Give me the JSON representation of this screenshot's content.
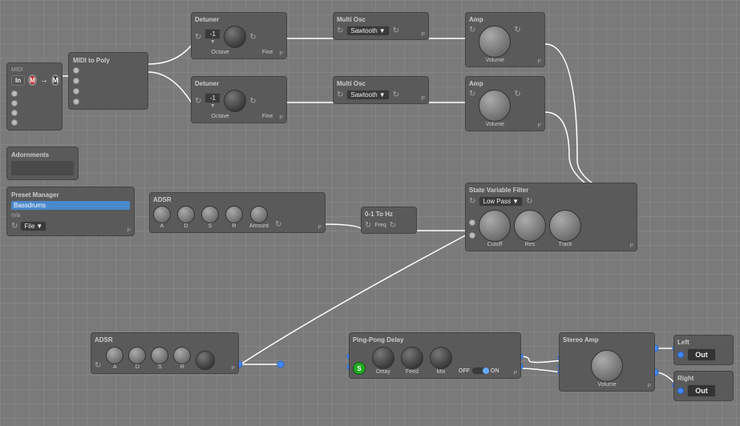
{
  "midi": {
    "title": "MIDI",
    "in_label": "In",
    "badge_label": "In"
  },
  "midi_to_poly": {
    "title": "MIDI to Poly"
  },
  "detuner1": {
    "title": "Detuner",
    "value": "-1",
    "octave_label": "Octave",
    "fine_label": "Fine"
  },
  "detuner2": {
    "title": "Detuner",
    "value": "-1",
    "octave_label": "Octave",
    "fine_label": "Fine"
  },
  "multiosc1": {
    "title": "Multi Osc",
    "waveform": "Sawtooth"
  },
  "multiosc2": {
    "title": "Multi Osc",
    "waveform": "Sawtooth"
  },
  "amp1": {
    "title": "Amp",
    "volume_label": "Volume"
  },
  "amp2": {
    "title": "Amp",
    "volume_label": "Volume"
  },
  "adornments": {
    "title": "Adornments"
  },
  "preset_manager": {
    "title": "Preset Manager",
    "text_value": "Bassdrums",
    "text_value2": "n/a",
    "file_label": "File",
    "dropdown_arrow": "▼"
  },
  "adsr1": {
    "title": "ADSR",
    "a_label": "A",
    "d_label": "D",
    "s_label": "S",
    "r_label": "R",
    "amount_label": "Amount"
  },
  "zero_to_hz": {
    "title": "0-1 To Hz",
    "freq_label": "Freq"
  },
  "svf": {
    "title": "State Variable Filter",
    "filter_type": "Low Pass",
    "cutoff_label": "Cutoff",
    "res_label": "Res",
    "track_label": "Track"
  },
  "adsr2": {
    "title": "ADSR",
    "a_label": "A",
    "d_label": "D",
    "s_label": "S",
    "r_label": "R"
  },
  "ping_pong": {
    "title": "Ping-Pong Delay",
    "delay_label": "Delay",
    "feed_label": "Feed",
    "mix_label": "Mix",
    "off_label": "OFF",
    "on_label": "ON"
  },
  "stereo_amp": {
    "title": "Stereo Amp",
    "volume_label": "Volume"
  },
  "out_left": {
    "label": "Left",
    "out": "Out"
  },
  "out_right": {
    "label": "Right",
    "out": "Out"
  }
}
